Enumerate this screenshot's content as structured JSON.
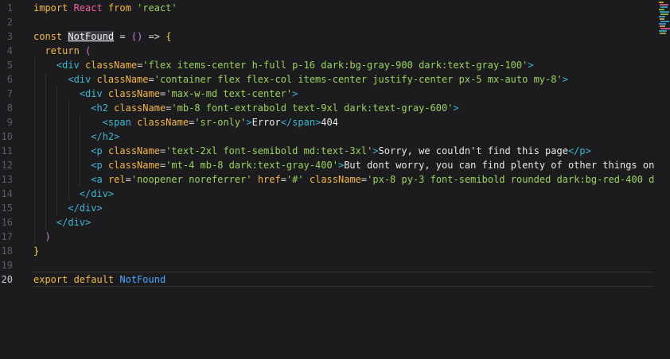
{
  "editor": {
    "active_line": 20,
    "lines": [
      {
        "n": "1",
        "tokens": [
          [
            "kw",
            "import "
          ],
          [
            "react",
            "React "
          ],
          [
            "kw",
            "from "
          ],
          [
            "str",
            "'react'"
          ]
        ]
      },
      {
        "n": "2",
        "tokens": []
      },
      {
        "n": "3",
        "tokens": [
          [
            "kw",
            "const "
          ],
          [
            "namehl",
            "NotFound"
          ],
          [
            "punct",
            " = "
          ],
          [
            "paren",
            "()"
          ],
          [
            "punct",
            " => "
          ],
          [
            "brace",
            "{"
          ]
        ]
      },
      {
        "n": "4",
        "tokens": [
          [
            "punct",
            "  "
          ],
          [
            "kw",
            "return "
          ],
          [
            "paren",
            "("
          ]
        ]
      },
      {
        "n": "5",
        "tokens": [
          [
            "punct",
            "    "
          ],
          [
            "tag",
            "<div "
          ],
          [
            "attr",
            "className"
          ],
          [
            "punct",
            "="
          ],
          [
            "str",
            "'flex items-center h-full p-16 dark:bg-gray-900 dark:text-gray-100'"
          ],
          [
            "tag",
            ">"
          ]
        ]
      },
      {
        "n": "6",
        "tokens": [
          [
            "punct",
            "      "
          ],
          [
            "tag",
            "<div "
          ],
          [
            "attr",
            "className"
          ],
          [
            "punct",
            "="
          ],
          [
            "str",
            "'container flex flex-col items-center justify-center px-5 mx-auto my-8'"
          ],
          [
            "tag",
            ">"
          ]
        ]
      },
      {
        "n": "7",
        "tokens": [
          [
            "punct",
            "        "
          ],
          [
            "tag",
            "<div "
          ],
          [
            "attr",
            "className"
          ],
          [
            "punct",
            "="
          ],
          [
            "str",
            "'max-w-md text-center'"
          ],
          [
            "tag",
            ">"
          ]
        ]
      },
      {
        "n": "8",
        "tokens": [
          [
            "punct",
            "          "
          ],
          [
            "tag",
            "<h2 "
          ],
          [
            "attr",
            "className"
          ],
          [
            "punct",
            "="
          ],
          [
            "str",
            "'mb-8 font-extrabold text-9xl dark:text-gray-600'"
          ],
          [
            "tag",
            ">"
          ]
        ]
      },
      {
        "n": "9",
        "tokens": [
          [
            "punct",
            "            "
          ],
          [
            "tag",
            "<span "
          ],
          [
            "attr",
            "className"
          ],
          [
            "punct",
            "="
          ],
          [
            "str",
            "'sr-only'"
          ],
          [
            "tag",
            ">"
          ],
          [
            "text",
            "Error"
          ],
          [
            "tag",
            "</span>"
          ],
          [
            "text",
            "404"
          ]
        ]
      },
      {
        "n": "10",
        "tokens": [
          [
            "punct",
            "          "
          ],
          [
            "tag",
            "</h2>"
          ]
        ]
      },
      {
        "n": "11",
        "tokens": [
          [
            "punct",
            "          "
          ],
          [
            "tag",
            "<p "
          ],
          [
            "attr",
            "className"
          ],
          [
            "punct",
            "="
          ],
          [
            "str",
            "'text-2xl font-semibold md:text-3xl'"
          ],
          [
            "tag",
            ">"
          ],
          [
            "text",
            "Sorry, we couldn't find this page"
          ],
          [
            "tag",
            "</p>"
          ]
        ]
      },
      {
        "n": "12",
        "tokens": [
          [
            "punct",
            "          "
          ],
          [
            "tag",
            "<p "
          ],
          [
            "attr",
            "className"
          ],
          [
            "punct",
            "="
          ],
          [
            "str",
            "'mt-4 mb-8 dark:text-gray-400'"
          ],
          [
            "tag",
            ">"
          ],
          [
            "text",
            "But dont worry, you can find plenty of other things on"
          ]
        ]
      },
      {
        "n": "13",
        "tokens": [
          [
            "punct",
            "          "
          ],
          [
            "tag",
            "<a "
          ],
          [
            "attr",
            "rel"
          ],
          [
            "punct",
            "="
          ],
          [
            "str",
            "'noopener noreferrer'"
          ],
          [
            "punct",
            " "
          ],
          [
            "attr",
            "href"
          ],
          [
            "punct",
            "="
          ],
          [
            "str",
            "'#'"
          ],
          [
            "punct",
            " "
          ],
          [
            "attr",
            "className"
          ],
          [
            "punct",
            "="
          ],
          [
            "str",
            "'px-8 py-3 font-semibold rounded dark:bg-red-400 d"
          ]
        ]
      },
      {
        "n": "14",
        "tokens": [
          [
            "punct",
            "        "
          ],
          [
            "tag",
            "</div>"
          ]
        ]
      },
      {
        "n": "15",
        "tokens": [
          [
            "punct",
            "      "
          ],
          [
            "tag",
            "</div>"
          ]
        ]
      },
      {
        "n": "16",
        "tokens": [
          [
            "punct",
            "    "
          ],
          [
            "tag",
            "</div>"
          ]
        ]
      },
      {
        "n": "17",
        "tokens": [
          [
            "punct",
            "  "
          ],
          [
            "paren",
            ")"
          ]
        ]
      },
      {
        "n": "18",
        "tokens": [
          [
            "brace",
            "}"
          ]
        ]
      },
      {
        "n": "19",
        "tokens": []
      },
      {
        "n": "20",
        "tokens": [
          [
            "kw",
            "export "
          ],
          [
            "kw",
            "default "
          ],
          [
            "export",
            "NotFound"
          ]
        ]
      }
    ]
  },
  "colors": {
    "background": "#1c1c1f",
    "keyword": "#f2b64c",
    "string": "#9bd15f",
    "tag": "#3fb7d1",
    "react": "#f0609e",
    "identifier_ref": "#4aa3ff"
  }
}
